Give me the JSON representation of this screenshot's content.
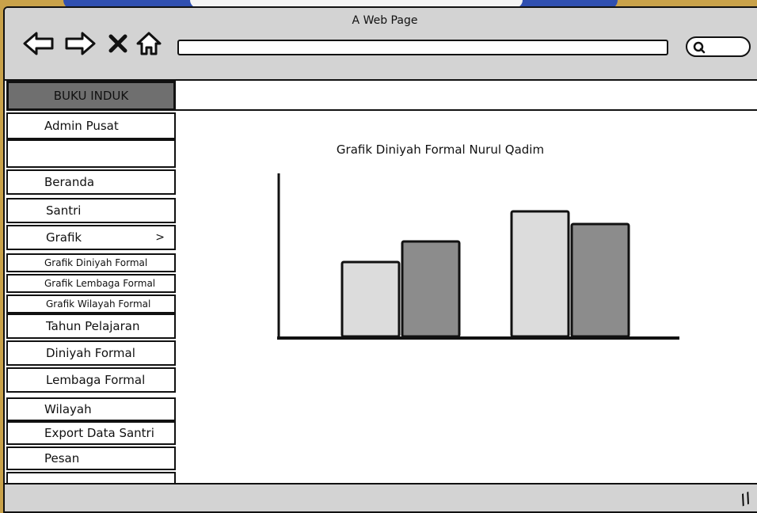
{
  "window": {
    "title": "A Web Page"
  },
  "nav_icons": [
    "back-arrow-icon",
    "forward-arrow-icon",
    "close-x-icon",
    "home-icon"
  ],
  "search_icon": "search-icon",
  "sidebar": {
    "header": "BUKU INDUK",
    "items": [
      {
        "label": "Admin Pusat"
      },
      {
        "label": ""
      },
      {
        "label": "Beranda"
      },
      {
        "label": "Santri"
      },
      {
        "label": "Grafik",
        "chevron": ">"
      },
      {
        "label": "Grafik Diniyah Formal"
      },
      {
        "label": "Grafik Lembaga Formal"
      },
      {
        "label": "Grafik Wilayah Formal"
      },
      {
        "label": "Tahun Pelajaran"
      },
      {
        "label": "Diniyah Formal"
      },
      {
        "label": "Lembaga Formal"
      },
      {
        "label": "Wilayah"
      },
      {
        "label": "Export Data Santri"
      },
      {
        "label": "Pesan"
      },
      {
        "label": ""
      }
    ]
  },
  "colors": {
    "bar_light": "#dcdcdc",
    "bar_dark": "#8c8c8c",
    "frame": "#d3d3d3"
  },
  "chart_data": {
    "type": "bar",
    "title": "Grafik Diniyah Formal Nurul Qadim",
    "xlabel": "",
    "ylabel": "",
    "categories": [
      "",
      ""
    ],
    "series": [
      {
        "values": [
          48,
          80
        ]
      },
      {
        "values": [
          61,
          72
        ]
      }
    ],
    "ylim": [
      0,
      100
    ]
  }
}
